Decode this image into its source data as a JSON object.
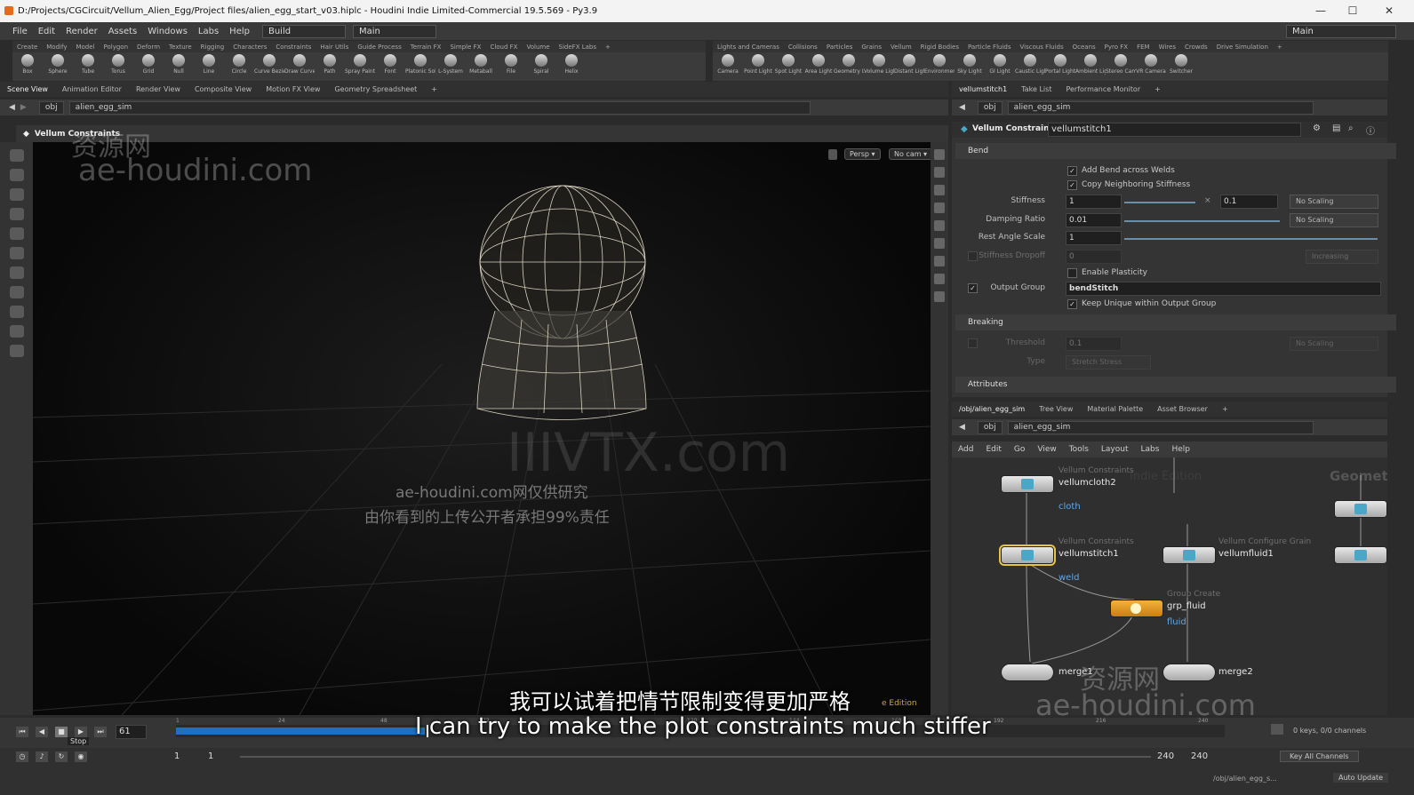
{
  "window": {
    "title": "D:/Projects/CGCircuit/Vellum_Alien_Egg/Project files/alien_egg_start_v03.hiplc - Houdini Indie Limited-Commercial 19.5.569 - Py3.9",
    "min": "—",
    "max": "☐",
    "close": "✕"
  },
  "menu": {
    "items": [
      "File",
      "Edit",
      "Render",
      "Assets",
      "Windows",
      "Labs",
      "Help"
    ],
    "desktop": "Build",
    "context": "Main",
    "right_context": "Main"
  },
  "shelf_tabs_left": [
    "Create",
    "Modify",
    "Model",
    "Polygon",
    "Deform",
    "Texture",
    "Rigging",
    "Characters",
    "Constraints",
    "Hair Utils",
    "Guide Process",
    "Terrain FX",
    "Simple FX",
    "Cloud FX",
    "Volume",
    "SideFX Labs",
    "+"
  ],
  "shelf_tabs_right": [
    "Lights and Cameras",
    "Collisions",
    "Particles",
    "Grains",
    "Vellum",
    "Rigid Bodies",
    "Particle Fluids",
    "Viscous Fluids",
    "Oceans",
    "Pyro FX",
    "FEM",
    "Wires",
    "Crowds",
    "Drive Simulation",
    "+"
  ],
  "shelf_tools_left": [
    "Box",
    "Sphere",
    "Tube",
    "Torus",
    "Grid",
    "Null",
    "Line",
    "Circle",
    "Curve Bezier",
    "Draw Curve",
    "Path",
    "Spray Paint",
    "Font",
    "Platonic Solids",
    "L-System",
    "Metaball",
    "File",
    "Spiral",
    "Helix"
  ],
  "shelf_tools_right": [
    "Camera",
    "Point Light",
    "Spot Light",
    "Area Light",
    "Geometry Light",
    "Volume Light",
    "Distant Light",
    "Environment Light",
    "Sky Light",
    "GI Light",
    "Caustic Light",
    "Portal Light",
    "Ambient Light",
    "Stereo Camera",
    "VR Camera",
    "Switcher"
  ],
  "viewer_tabs": [
    "Scene View",
    "Animation Editor",
    "Render View",
    "Composite View",
    "Motion FX View",
    "Geometry Spreadsheet",
    "+"
  ],
  "viewer_path": {
    "root": "obj",
    "node": "alien_egg_sim"
  },
  "viewer_header": "Vellum Constraints",
  "viewport": {
    "persp": "Persp ▾",
    "cam": "No cam ▾",
    "edition": "e Edition"
  },
  "param_tabs": [
    "vellumstitch1",
    "Take List",
    "Performance Monitor",
    "+"
  ],
  "param_path": {
    "root": "obj",
    "node": "alien_egg_sim"
  },
  "param_header": {
    "type": "Vellum Constraints",
    "name": "vellumstitch1"
  },
  "params": {
    "bend_section": "Bend",
    "add_bend_across_welds": "Add Bend across Welds",
    "copy_neighboring_stiffness": "Copy Neighboring Stiffness",
    "stiffness_label": "Stiffness",
    "stiffness_value": "1",
    "stiffness_mult": "×",
    "stiffness_exp": "0.1",
    "stiffness_scaling": "No Scaling",
    "damping_label": "Damping Ratio",
    "damping_value": "0.01",
    "damping_scaling": "No Scaling",
    "rest_angle_label": "Rest Angle Scale",
    "rest_angle_value": "1",
    "stiffness_dropoff_label": "Stiffness Dropoff",
    "stiffness_dropoff_value": "0",
    "stiffness_dropoff_mode": "Increasing",
    "enable_plasticity": "Enable Plasticity",
    "output_group_label": "Output Group",
    "output_group_value": "bendStitch",
    "keep_unique": "Keep Unique within Output Group",
    "breaking_section": "Breaking",
    "threshold_label": "Threshold",
    "threshold_value": "0.1",
    "threshold_scaling": "No Scaling",
    "type_label": "Type",
    "type_value": "Stretch Stress",
    "attributes_section": "Attributes"
  },
  "net_tabs": [
    "/obj/alien_egg_sim",
    "Tree View",
    "Material Palette",
    "Asset Browser",
    "+"
  ],
  "net_path": {
    "root": "obj",
    "node": "alien_egg_sim"
  },
  "net_menu": [
    "Add",
    "Edit",
    "Go",
    "View",
    "Tools",
    "Layout",
    "Labs",
    "Help"
  ],
  "net_corner": "Geometry",
  "net_watermark": "Indie Edition",
  "nodes": {
    "n1": {
      "type": "Vellum Constraints",
      "name": "vellumcloth2",
      "group": "cloth"
    },
    "n2": {
      "type": "Vellum Constraints",
      "name": "vellumstitch1",
      "group": "weld"
    },
    "n3": {
      "type": "Vellum Configure Grain",
      "name": "vellumfluid1"
    },
    "n4": {
      "type": "Group Create",
      "name": "grp_fluid",
      "group": "fluid"
    },
    "n5": {
      "name": "merge1"
    },
    "n6": {
      "name": "merge2"
    }
  },
  "timeline": {
    "frame": "61",
    "ticks": [
      "1",
      "24",
      "48",
      "72",
      "96",
      "120",
      "144",
      "168",
      "192",
      "216",
      "240"
    ],
    "start": "1",
    "start2": "1",
    "end": "240",
    "end2": "240",
    "stop_tooltip": "Stop",
    "keys_info": "0 keys, 0/0 channels",
    "key_all": "Key All Channels",
    "path": "/obj/alien_egg_s...",
    "auto_update": "Auto Update"
  },
  "watermarks": {
    "w1": "资源网",
    "w2": "ae-houdini.com",
    "w3": "IIIVTX.com",
    "w4": "ae-houdini.com网仅供研究",
    "w5": "由你看到的上传公开者承担99%责任",
    "w6": "资源网",
    "w7": "ae-houdini.com"
  },
  "subtitles": {
    "zh": "我可以试着把情节限制变得更加严格",
    "en": "I can try to make the plot constraints much stiffer"
  }
}
